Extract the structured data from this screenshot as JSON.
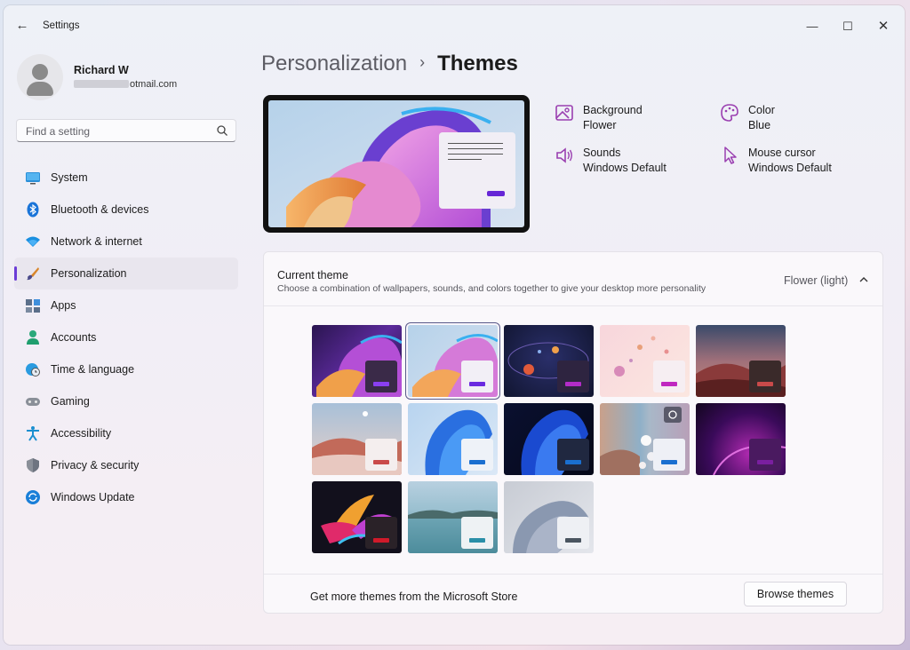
{
  "window": {
    "title": "Settings",
    "back_icon": "←",
    "min_icon": "—",
    "max_icon": "☐",
    "close_icon": "✕"
  },
  "user": {
    "name": "Richard W",
    "email_visible": "otmail.com"
  },
  "search": {
    "placeholder": "Find a setting"
  },
  "nav": [
    {
      "label": "System",
      "icon": "monitor-icon",
      "active": false
    },
    {
      "label": "Bluetooth & devices",
      "icon": "bluetooth-icon",
      "active": false
    },
    {
      "label": "Network & internet",
      "icon": "wifi-icon",
      "active": false
    },
    {
      "label": "Personalization",
      "icon": "paintbrush-icon",
      "active": true
    },
    {
      "label": "Apps",
      "icon": "apps-icon",
      "active": false
    },
    {
      "label": "Accounts",
      "icon": "person-icon",
      "active": false
    },
    {
      "label": "Time & language",
      "icon": "globe-clock-icon",
      "active": false
    },
    {
      "label": "Gaming",
      "icon": "gamepad-icon",
      "active": false
    },
    {
      "label": "Accessibility",
      "icon": "accessibility-icon",
      "active": false
    },
    {
      "label": "Privacy & security",
      "icon": "shield-icon",
      "active": false
    },
    {
      "label": "Windows Update",
      "icon": "update-icon",
      "active": false
    }
  ],
  "breadcrumb": {
    "parent": "Personalization",
    "sep": "›",
    "current": "Themes"
  },
  "properties": {
    "background": {
      "name": "Background",
      "value": "Flower"
    },
    "color": {
      "name": "Color",
      "value": "Blue"
    },
    "sounds": {
      "name": "Sounds",
      "value": "Windows Default"
    },
    "cursor": {
      "name": "Mouse cursor",
      "value": "Windows Default"
    }
  },
  "current_theme": {
    "title": "Current theme",
    "subtitle": "Choose a combination of wallpapers, sounds, and colors together to give your desktop more personality",
    "value": "Flower (light)"
  },
  "themes": [
    {
      "id": "flower-dark",
      "selected": false,
      "accent": "#8a3ff0"
    },
    {
      "id": "flower-light",
      "selected": true,
      "accent": "#6a2ae0"
    },
    {
      "id": "planets",
      "selected": false,
      "accent": "#b32cc8"
    },
    {
      "id": "pastel-dots",
      "selected": false,
      "accent": "#c028c0"
    },
    {
      "id": "dune-dark",
      "selected": false,
      "accent": "#c94a4a"
    },
    {
      "id": "dune-light",
      "selected": false,
      "accent": "#c94a4a"
    },
    {
      "id": "windows-light",
      "selected": false,
      "accent": "#1a6fd0"
    },
    {
      "id": "windows-dark",
      "selected": false,
      "accent": "#1a6fd0"
    },
    {
      "id": "spotlight",
      "selected": false,
      "accent": "#1a6fd0"
    },
    {
      "id": "glow",
      "selected": false,
      "accent": "#7a1fa0"
    },
    {
      "id": "captured-motion",
      "selected": false,
      "accent": "#d01a2a"
    },
    {
      "id": "lake",
      "selected": false,
      "accent": "#2a8fa8"
    },
    {
      "id": "sunrise",
      "selected": false,
      "accent": "#4a5560"
    }
  ],
  "footer": {
    "text": "Get more themes from the Microsoft Store",
    "button": "Browse themes"
  }
}
